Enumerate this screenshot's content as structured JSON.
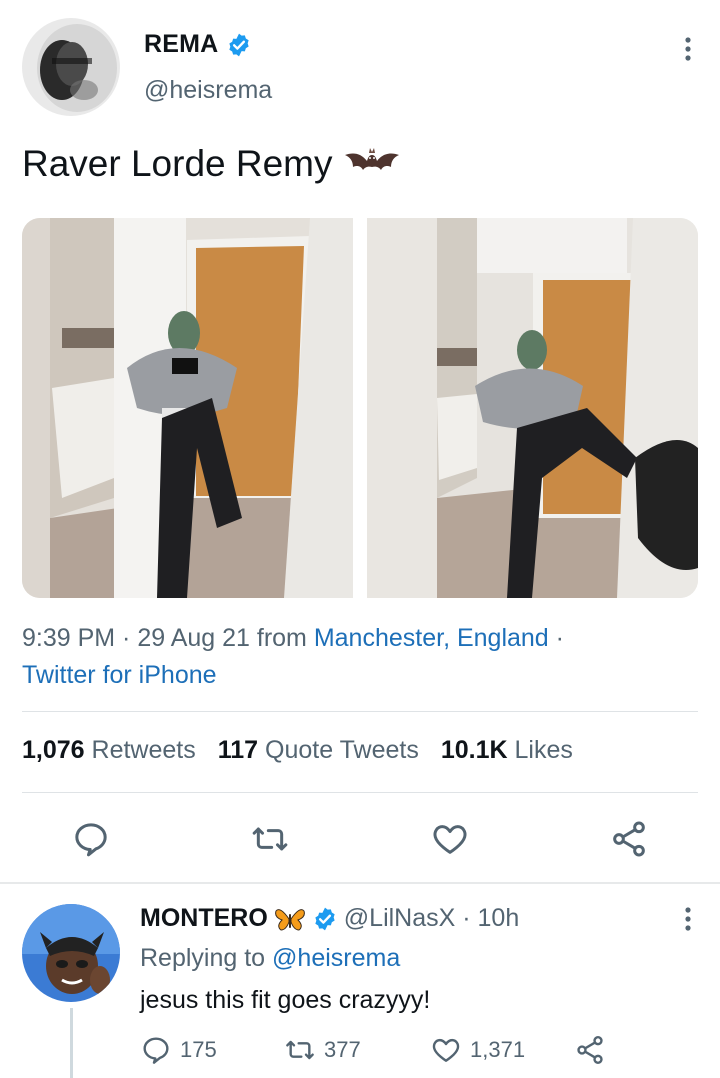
{
  "tweet": {
    "display_name": "REMA",
    "handle": "@heisrema",
    "text": "Raver Lorde Remy",
    "text_emoji": "bat",
    "time": "9:39 PM · 29 Aug 21 from ",
    "location": "Manchester, England",
    "location_sep": " ·",
    "source": "Twitter for iPhone",
    "stats": {
      "retweets_count": "1,076",
      "retweets_label": "Retweets",
      "quotes_count": "117",
      "quotes_label": "Quote Tweets",
      "likes_count": "10.1K",
      "likes_label": "Likes"
    }
  },
  "reply": {
    "display_name": "MONTERO",
    "emoji": "butterfly",
    "handle_time": "@LilNasX · 10h",
    "replying_prefix": "Replying to ",
    "replying_to": "@heisrema",
    "text": "jesus this fit goes crazyyy!",
    "replies": "175",
    "retweets": "377",
    "likes": "1,371"
  },
  "colors": {
    "verified": "#1d9bf0",
    "link": "#1d6fb8",
    "secondary_text": "#536471"
  }
}
